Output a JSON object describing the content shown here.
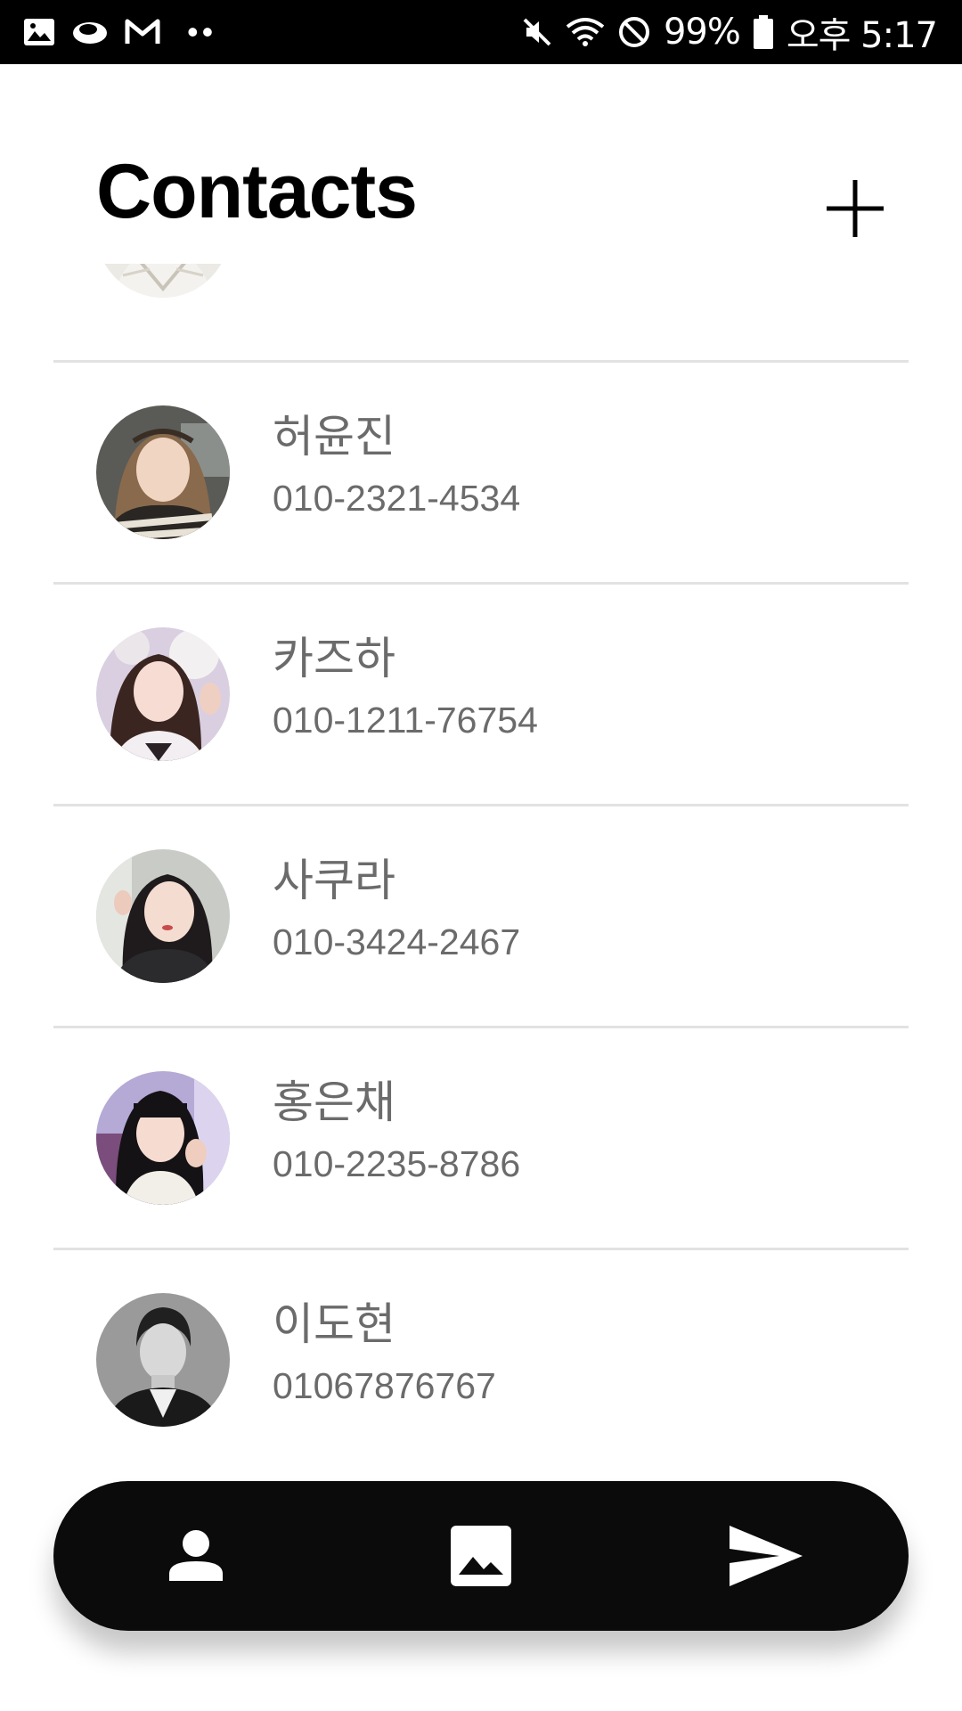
{
  "status_bar": {
    "battery_percent": "99%",
    "time": "오후 5:17",
    "icons": [
      "gallery-notification-icon",
      "cloud-notification-icon",
      "gmail-icon",
      "more-notifications-icon",
      "mute-icon",
      "wifi-icon",
      "do-not-disturb-icon",
      "battery-icon"
    ]
  },
  "header": {
    "title": "Contacts",
    "add_icon": "plus-icon"
  },
  "contacts": [
    {
      "name": "허윤진",
      "phone": "010-2321-4534"
    },
    {
      "name": "카즈하",
      "phone": "010-1211-76754"
    },
    {
      "name": "사쿠라",
      "phone": "010-3424-2467"
    },
    {
      "name": "홍은채",
      "phone": "010-2235-8786"
    },
    {
      "name": "이도현",
      "phone": "01067876767"
    }
  ],
  "bottom_nav": {
    "items": [
      {
        "icon": "person-icon",
        "id": "contacts"
      },
      {
        "icon": "image-icon",
        "id": "gallery"
      },
      {
        "icon": "send-icon",
        "id": "send"
      }
    ]
  },
  "colors": {
    "background": "#ffffff",
    "status_bar": "#000000",
    "text_secondary": "#6b6b6b",
    "divider": "#e2e2e2",
    "nav_bar": "#0b0b0b"
  }
}
